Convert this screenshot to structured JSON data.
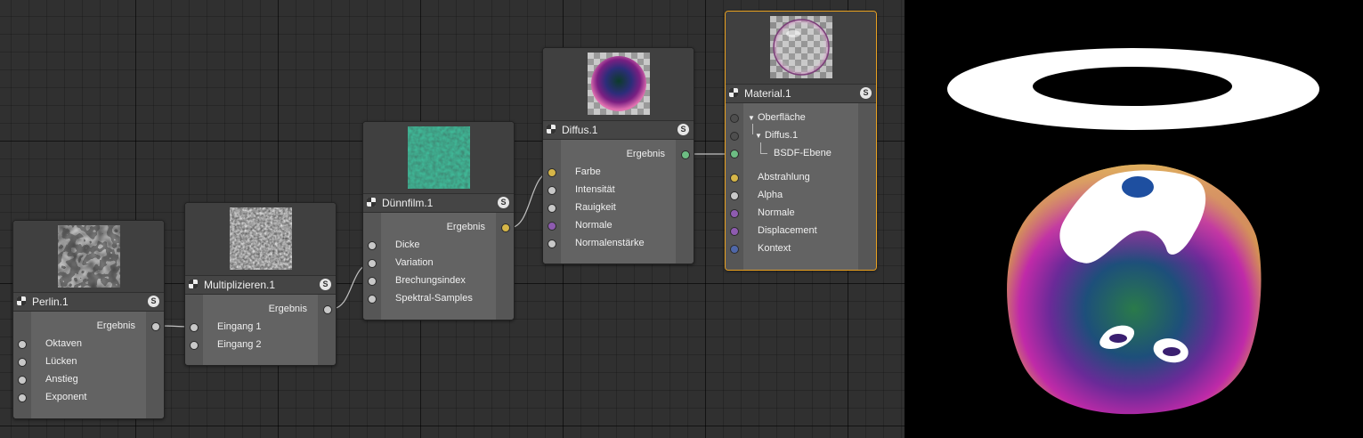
{
  "colors": {
    "canvas": "#303030",
    "node_body": "#5b5b5b",
    "selected_border": "#e8a020",
    "port_white": "#c8c8c8",
    "port_yellow": "#d6b648",
    "port_green": "#6dbd83",
    "port_purple": "#8e5bb0",
    "port_blue": "#4f67a8",
    "port_gray": "#4e4e4e"
  },
  "nodes": {
    "perlin": {
      "title": "Perlin.1",
      "output": "Ergebnis",
      "inputs": [
        "Oktaven",
        "Lücken",
        "Anstieg",
        "Exponent"
      ]
    },
    "multiply": {
      "title": "Multiplizieren.1",
      "output": "Ergebnis",
      "inputs": [
        "Eingang 1",
        "Eingang 2"
      ]
    },
    "thinfilm": {
      "title": "Dünnfilm.1",
      "output": "Ergebnis",
      "inputs": [
        "Dicke",
        "Variation",
        "Brechungsindex",
        "Spektral-Samples"
      ]
    },
    "diffuse": {
      "title": "Diffus.1",
      "output": "Ergebnis",
      "inputs": [
        "Farbe",
        "Intensität",
        "Rauigkeit",
        "Normale",
        "Normalenstärke"
      ]
    },
    "material": {
      "title": "Material.1",
      "tree": [
        "Oberfläche",
        "Diffus.1",
        "BSDF-Ebene"
      ],
      "inputs": [
        "Abstrahlung",
        "Alpha",
        "Normale",
        "Displacement",
        "Kontext"
      ]
    }
  },
  "solo_label": "S"
}
